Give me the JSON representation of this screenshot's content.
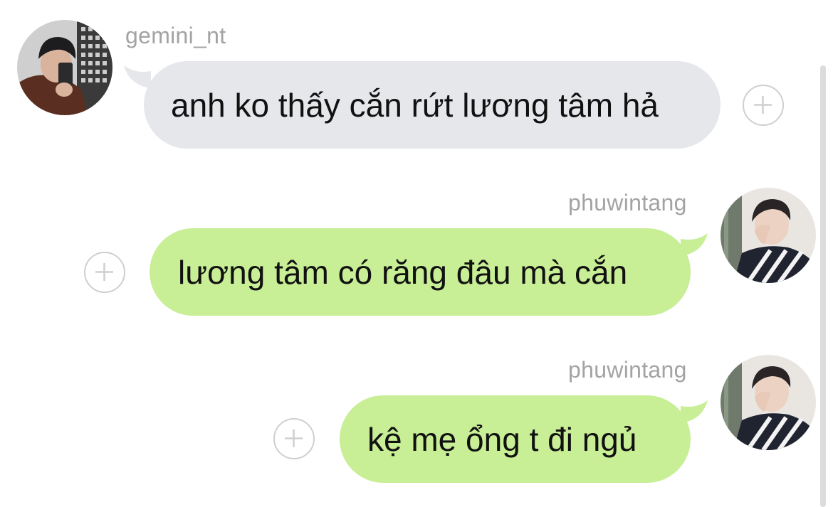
{
  "messages": [
    {
      "sender": "gemini_nt",
      "direction": "incoming",
      "text": "anh ko thấy cắn rứt lương tâm hả",
      "avatar": "avatar-gemini"
    },
    {
      "sender": "phuwintang",
      "direction": "outgoing",
      "text": "lương tâm có răng đâu mà cắn",
      "avatar": "avatar-phuwin"
    },
    {
      "sender": "phuwintang",
      "direction": "outgoing",
      "text": "kệ mẹ ổng t đi ngủ",
      "avatar": "avatar-phuwin"
    }
  ],
  "icons": {
    "react": "plus-circle-icon"
  },
  "colors": {
    "incoming_bubble": "#e5e7ea",
    "outgoing_bubble": "#c8ee96",
    "username": "#a3a3a3",
    "text": "#111111"
  }
}
